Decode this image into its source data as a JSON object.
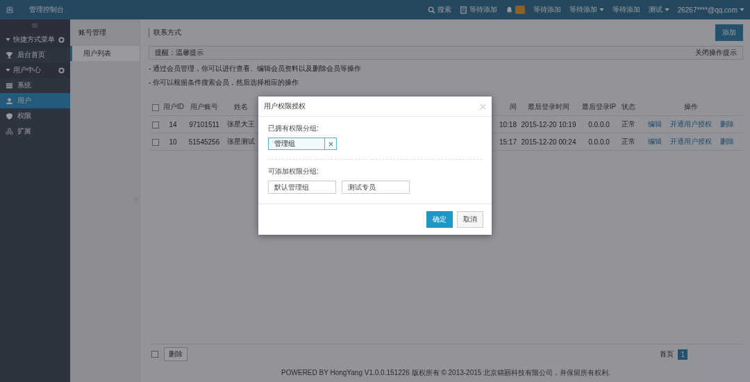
{
  "topbar": {
    "title": "管理控制台",
    "items": [
      {
        "kind": "search",
        "label": "搜索",
        "dropdown": false
      },
      {
        "kind": "doc",
        "label": "等待添加",
        "dropdown": false
      },
      {
        "kind": "bell",
        "dropdown": false
      },
      {
        "kind": "text",
        "label": "等待添加",
        "dropdown": false
      },
      {
        "kind": "text",
        "label": "等待添加",
        "dropdown": true
      },
      {
        "kind": "text",
        "label": "等待添加",
        "dropdown": false
      },
      {
        "kind": "text",
        "label": "测试",
        "dropdown": true
      },
      {
        "kind": "text",
        "label": "26267****@qq.com",
        "dropdown": true
      }
    ]
  },
  "sidebar": {
    "items": [
      {
        "kind": "group",
        "label": "快捷方式菜单",
        "selected": false
      },
      {
        "kind": "item",
        "label": "后台首页",
        "selected": false
      },
      {
        "kind": "group",
        "label": "用户中心",
        "selected": false
      },
      {
        "kind": "item",
        "label": "系统",
        "selected": false
      },
      {
        "kind": "item",
        "label": "用户",
        "selected": true
      },
      {
        "kind": "item",
        "label": "权限",
        "selected": false
      },
      {
        "kind": "item",
        "label": "扩展",
        "selected": false
      }
    ]
  },
  "subnav": {
    "heading": "账号管理",
    "items": [
      {
        "label": "用户列表",
        "selected": true
      }
    ]
  },
  "main": {
    "title": "联系方式",
    "add_button": "添加",
    "tips": {
      "title": "提醒：温馨提示",
      "close": "关闭操作提示",
      "lines": [
        "- 通过会员管理，你可以进行查看、编辑会员资料以及删除会员等操作",
        "- 你可以根据条件搜索会员，然后选择相应的操作"
      ]
    },
    "table": {
      "select_all_checked": false,
      "columns": [
        "用户ID",
        "用户账号",
        "姓名",
        "间",
        "最后登录时间",
        "最后登录IP",
        "状态",
        "操作"
      ],
      "rows": [
        {
          "checked": false,
          "cells": [
            "14",
            "97101511",
            "张星大王",
            "10:18",
            "2015-12-20 10:19",
            "0.0.0.0",
            "正常"
          ],
          "actions": [
            "编辑",
            "开通用户授权",
            "删除"
          ]
        },
        {
          "checked": false,
          "cells": [
            "10",
            "51545256",
            "张星测试",
            "15:17",
            "2015-12-20 00:24",
            "0.0.0.0",
            "正常"
          ],
          "actions": [
            "编辑",
            "开通用户授权",
            "删除"
          ]
        }
      ]
    },
    "bottom_select_checked": false,
    "bulk_delete": "删除",
    "pagination": {
      "first": "首页",
      "pages": [
        {
          "label": "1",
          "selected": true
        }
      ]
    },
    "footer": "POWERED BY HongYang V1.0.0.151226 版权所有 © 2013-2015 北京锦丽科技有限公司，并保留所有权利."
  },
  "dialog": {
    "title": "用户权限授权",
    "owned_label": "已拥有权限分组:",
    "owned": [
      "管理组"
    ],
    "available_label": "可添加权限分组:",
    "available": [
      "默认管理组",
      "测试专员"
    ],
    "buttons": [
      {
        "kind": "primary",
        "label": "确定"
      },
      {
        "kind": "default",
        "label": "取消"
      }
    ]
  }
}
